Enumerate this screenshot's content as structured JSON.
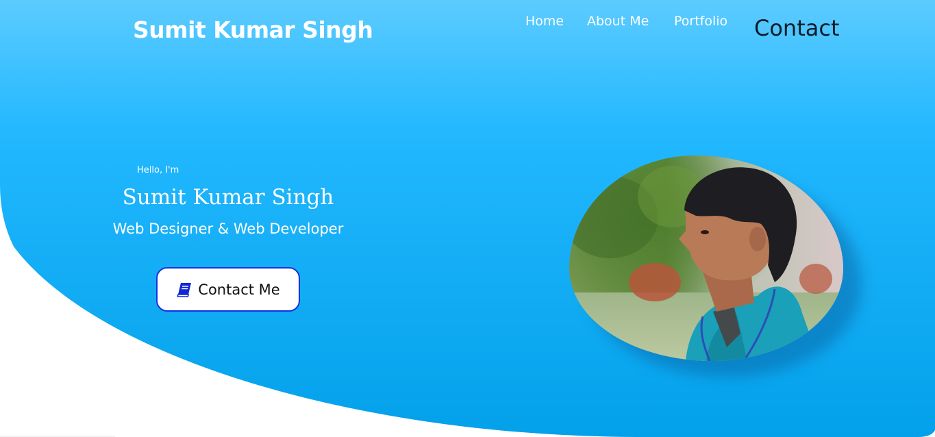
{
  "header": {
    "brand": "Sumit Kumar Singh",
    "nav": [
      {
        "label": "Home"
      },
      {
        "label": "About Me"
      },
      {
        "label": "Portfolio"
      },
      {
        "label": "Contact"
      }
    ]
  },
  "hero": {
    "greeting": "Hello, I'm",
    "name": "Sumit Kumar Singh",
    "role": "Web Designer & Web Developer",
    "cta": {
      "label": "Contact Me",
      "icon": "book-icon"
    }
  },
  "portrait": {
    "icon": "profile-photo"
  },
  "colors": {
    "hero_top": "#5ccbff",
    "hero_bottom": "#03a1ea",
    "cta_border": "#1530e0",
    "cta_icon": "#1226d6",
    "active_nav": "#0d1b2a"
  }
}
